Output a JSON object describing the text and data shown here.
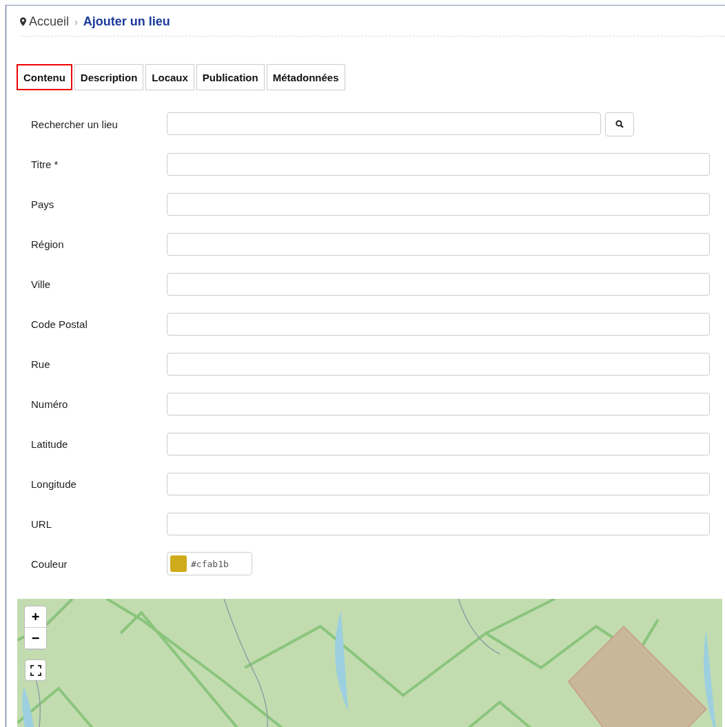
{
  "breadcrumb": {
    "home": "Accueil",
    "separator": "›",
    "current": "Ajouter un lieu"
  },
  "tabs": [
    {
      "label": "Contenu",
      "selected": true
    },
    {
      "label": "Description",
      "selected": false
    },
    {
      "label": "Locaux",
      "selected": false
    },
    {
      "label": "Publication",
      "selected": false
    },
    {
      "label": "Métadonnées",
      "selected": false
    }
  ],
  "fields": [
    {
      "kind": "search",
      "label": "Rechercher un lieu"
    },
    {
      "kind": "text",
      "label": "Titre *"
    },
    {
      "kind": "text",
      "label": "Pays"
    },
    {
      "kind": "text",
      "label": "Région"
    },
    {
      "kind": "text",
      "label": "Ville"
    },
    {
      "kind": "text",
      "label": "Code Postal"
    },
    {
      "kind": "text",
      "label": "Rue"
    },
    {
      "kind": "text",
      "label": "Numéro"
    },
    {
      "kind": "text",
      "label": "Latitude"
    },
    {
      "kind": "text",
      "label": "Longitude"
    },
    {
      "kind": "text",
      "label": "URL"
    },
    {
      "kind": "color",
      "label": "Couleur",
      "value": "#cfab1b",
      "color": "#cfab1b"
    }
  ],
  "map": {
    "zoom_in": "+",
    "zoom_out": "−"
  }
}
